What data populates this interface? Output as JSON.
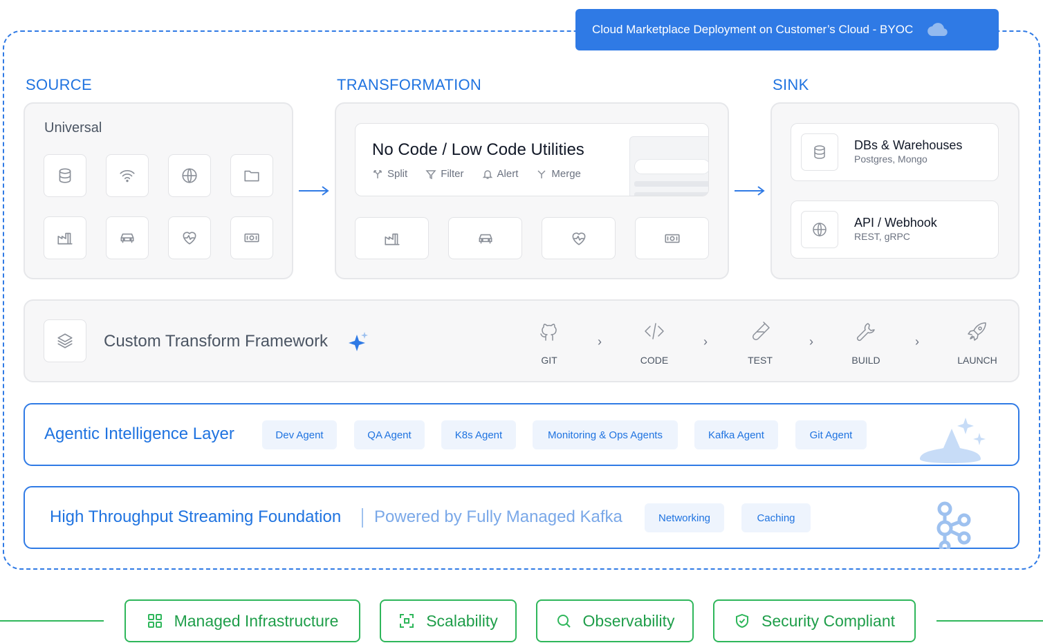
{
  "byoc": {
    "label": "Cloud Marketplace Deployment on Customer’s Cloud - BYOC",
    "icon": "cloud-icon"
  },
  "source": {
    "title": "SOURCE",
    "subtitle": "Universal",
    "icons": [
      "database-icon",
      "wifi-icon",
      "globe-icon",
      "folder-icon",
      "factory-icon",
      "car-icon",
      "heart-pulse-icon",
      "money-icon"
    ]
  },
  "transformation": {
    "title": "TRANSFORMATION",
    "card_title": "No Code / Low Code Utilities",
    "utilities": [
      "Split",
      "Filter",
      "Alert",
      "Merge"
    ],
    "icons": [
      "factory-icon",
      "car-icon",
      "heart-pulse-icon",
      "money-icon"
    ]
  },
  "sink": {
    "title": "SINK",
    "cards": [
      {
        "title": "DBs & Warehouses",
        "subtitle": "Postgres, Mongo",
        "icon": "database-icon"
      },
      {
        "title": "API / Webhook",
        "subtitle": "REST, gRPC",
        "icon": "globe-icon"
      }
    ]
  },
  "custom_transform": {
    "title": "Custom Transform Framework",
    "steps": [
      "GIT",
      "CODE",
      "TEST",
      "BUILD",
      "LAUNCH"
    ]
  },
  "agentic": {
    "title": "Agentic Intelligence Layer",
    "agents": [
      "Dev Agent",
      "QA Agent",
      "K8s Agent",
      "Monitoring & Ops Agents",
      "Kafka Agent",
      "Git Agent"
    ]
  },
  "foundation": {
    "title": "High Throughput Streaming Foundation",
    "subtitle": "Powered by Fully Managed Kafka",
    "tags": [
      "Networking",
      "Caching"
    ]
  },
  "features": [
    "Managed Infrastructure",
    "Scalability",
    "Observability",
    "Security Compliant"
  ],
  "colors": {
    "primary_blue": "#2f7ae5",
    "green": "#2eb65a",
    "panel_bg": "#f7f7f8"
  }
}
